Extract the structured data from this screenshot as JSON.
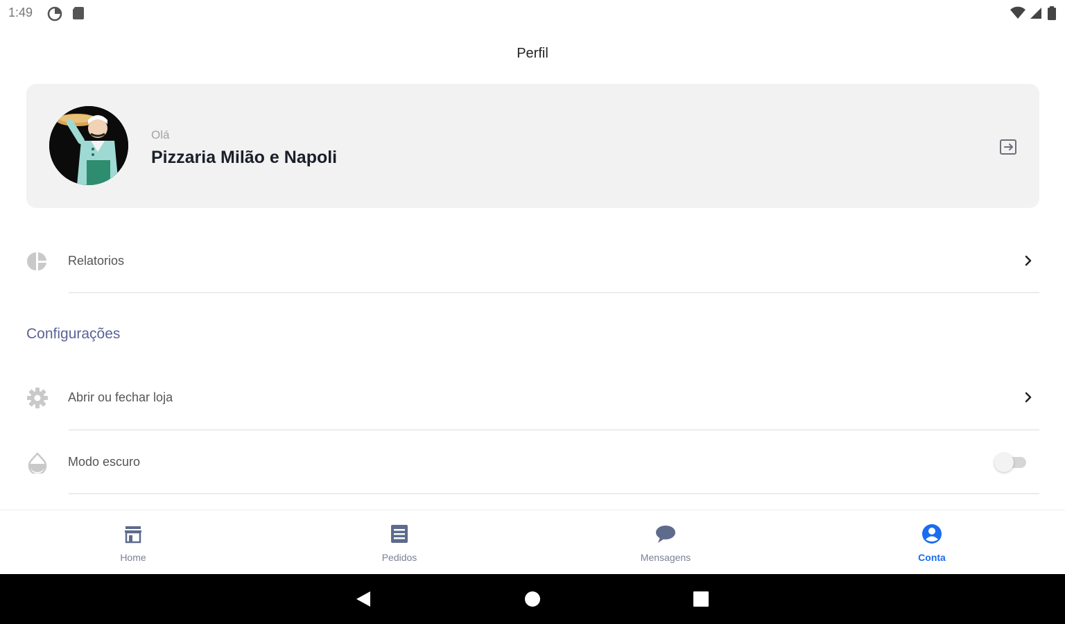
{
  "status_bar": {
    "time": "1:49"
  },
  "header": {
    "title": "Perfil"
  },
  "profile": {
    "greeting": "Olá",
    "store_name": "Pizzaria Milão e Napoli"
  },
  "menu": {
    "reports_label": "Relatorios",
    "section_title": "Configurações",
    "open_close_label": "Abrir ou fechar loja",
    "dark_mode_label": "Modo escuro",
    "dark_mode_enabled": false
  },
  "bottom_nav": {
    "tabs": [
      {
        "label": "Home",
        "icon": "store-icon",
        "active": false
      },
      {
        "label": "Pedidos",
        "icon": "list-icon",
        "active": false
      },
      {
        "label": "Mensagens",
        "icon": "chat-icon",
        "active": false
      },
      {
        "label": "Conta",
        "icon": "account-icon",
        "active": true
      }
    ]
  },
  "colors": {
    "accent": "#1a6cf0",
    "section": "#5b6396",
    "card_bg": "#f2f2f2"
  }
}
